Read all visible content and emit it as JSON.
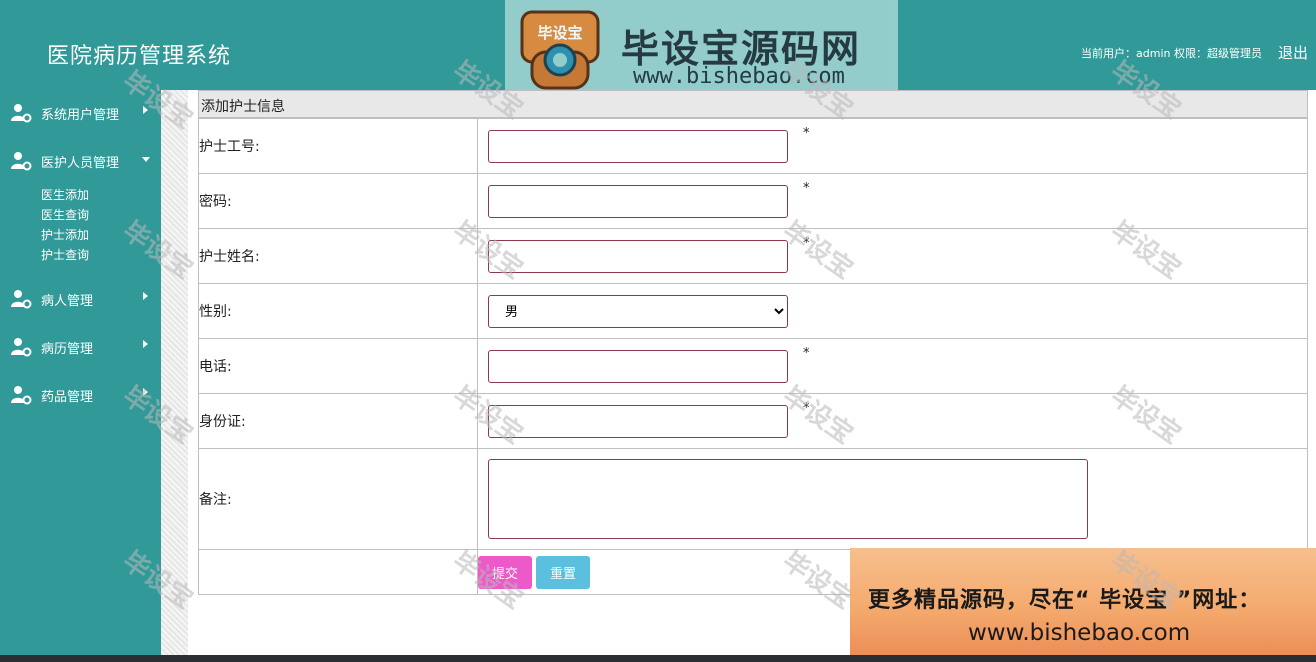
{
  "header": {
    "app_title": "医院病历管理系统",
    "user_info": "当前用户：admin 权限：超级管理员",
    "logout_label": "退出"
  },
  "logo": {
    "badge_text": "毕设宝",
    "brand_text": "毕设宝源码网",
    "url": "www.bishebao.com"
  },
  "sidebar": {
    "menus": [
      {
        "label": "系统用户管理",
        "expanded": false,
        "icon": "user-gear-icon"
      },
      {
        "label": "医护人员管理",
        "expanded": true,
        "icon": "user-gear-icon",
        "children": [
          "医生添加",
          "医生查询",
          "护士添加",
          "护士查询"
        ]
      },
      {
        "label": "病人管理",
        "expanded": false,
        "icon": "user-gear-icon"
      },
      {
        "label": "病历管理",
        "expanded": false,
        "icon": "user-gear-icon"
      },
      {
        "label": "药品管理",
        "expanded": false,
        "icon": "user-gear-icon"
      }
    ]
  },
  "form": {
    "title": "添加护士信息",
    "fields": {
      "nurse_id": {
        "label": "护士工号:",
        "value": "",
        "required": "*"
      },
      "password": {
        "label": "密码:",
        "value": "",
        "required": "*"
      },
      "name": {
        "label": "护士姓名:",
        "value": "",
        "required": "*"
      },
      "gender": {
        "label": "性别:",
        "selected": "男"
      },
      "phone": {
        "label": "电话:",
        "value": "",
        "required": "*"
      },
      "id_card": {
        "label": "身份证:",
        "value": "",
        "required": "*"
      },
      "remark": {
        "label": "备注:",
        "value": ""
      }
    },
    "submit_label": "提交",
    "reset_label": "重置"
  },
  "ad": {
    "line1": "更多精品源码，尽在“ 毕设宝 ”网址：",
    "line2": "www.bishebao.com"
  },
  "watermark": "毕设宝",
  "colors": {
    "primary": "#319a98",
    "submit": "#ee59c9",
    "reset": "#5bc0de",
    "input_border": "#8a3a4a"
  }
}
